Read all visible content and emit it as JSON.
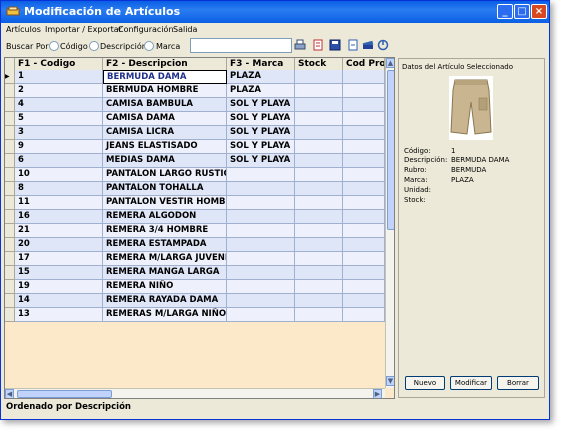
{
  "window": {
    "title": "Modificación de Artículos"
  },
  "menu": [
    "Artículos",
    "Importar / Exportar",
    "Configuración",
    "Salida"
  ],
  "search": {
    "label": "Buscar Por :",
    "options": [
      "Código",
      "Descripción",
      "Marca"
    ],
    "value": ""
  },
  "toolbar_icons": [
    "printer-icon",
    "document-icon",
    "save-icon",
    "edit-icon",
    "books-icon",
    "exit-icon"
  ],
  "grid": {
    "columns": [
      "F1 - Codigo",
      "F2 - Descripcion",
      "F3 - Marca",
      "Stock",
      "Cod Pro"
    ],
    "rows": [
      {
        "codigo": "1",
        "descripcion": "BERMUDA DAMA",
        "marca": "PLAZA"
      },
      {
        "codigo": "2",
        "descripcion": "BERMUDA HOMBRE",
        "marca": "PLAZA"
      },
      {
        "codigo": "4",
        "descripcion": "CAMISA BAMBULA",
        "marca": "SOL Y PLAYA"
      },
      {
        "codigo": "5",
        "descripcion": "CAMISA DAMA",
        "marca": "SOL Y PLAYA"
      },
      {
        "codigo": "3",
        "descripcion": "CAMISA LICRA",
        "marca": "SOL Y PLAYA"
      },
      {
        "codigo": "9",
        "descripcion": "JEANS ELASTISADO",
        "marca": "SOL Y PLAYA"
      },
      {
        "codigo": "6",
        "descripcion": "MEDIAS DAMA",
        "marca": "SOL Y PLAYA"
      },
      {
        "codigo": "10",
        "descripcion": "PANTALON LARGO RUSTICO",
        "marca": ""
      },
      {
        "codigo": "8",
        "descripcion": "PANTALON TOHALLA",
        "marca": ""
      },
      {
        "codigo": "11",
        "descripcion": "PANTALON VESTIR HOMBRE",
        "marca": ""
      },
      {
        "codigo": "16",
        "descripcion": "REMERA  ALGODON",
        "marca": ""
      },
      {
        "codigo": "21",
        "descripcion": "REMERA 3/4 HOMBRE",
        "marca": ""
      },
      {
        "codigo": "20",
        "descripcion": "REMERA ESTAMPADA",
        "marca": ""
      },
      {
        "codigo": "17",
        "descripcion": "REMERA M/LARGA JUVENIL",
        "marca": ""
      },
      {
        "codigo": "15",
        "descripcion": "REMERA MANGA LARGA",
        "marca": ""
      },
      {
        "codigo": "19",
        "descripcion": "REMERA NIÑO",
        "marca": ""
      },
      {
        "codigo": "14",
        "descripcion": "REMERA RAYADA DAMA",
        "marca": ""
      },
      {
        "codigo": "13",
        "descripcion": "REMERAS M/LARGA NIÑO",
        "marca": ""
      }
    ]
  },
  "detail": {
    "title": "Datos del Artículo Seleccionado",
    "labels": [
      "Código:",
      "Descripción:",
      "Rubro:",
      "Marca:",
      "Unidad:",
      "Stock:"
    ],
    "values": [
      "1",
      "BERMUDA DAMA",
      "BERMUDA",
      "PLAZA",
      "",
      ""
    ],
    "buttons": [
      "Nuevo",
      "Modificar",
      "Borrar"
    ]
  },
  "status": "Ordenado por Descripción",
  "colors": {
    "row_blue": "#dfe6f7",
    "row_light": "#eef1fb",
    "grid_bg": "#fbe9c9",
    "title_blue": "#0a5fe4"
  }
}
